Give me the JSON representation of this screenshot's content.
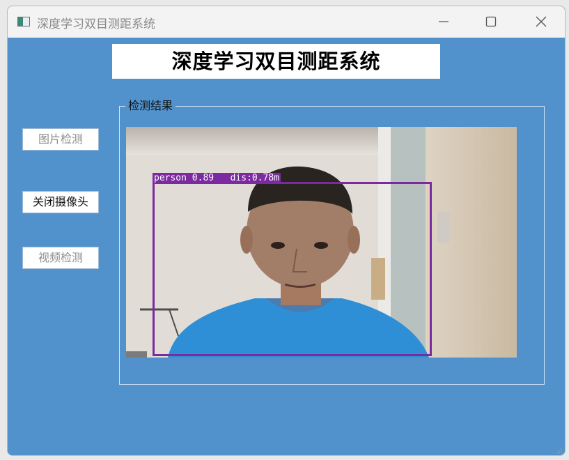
{
  "window": {
    "title": "深度学习双目测距系统",
    "controls": {
      "minimize_icon": "minimize-icon",
      "maximize_icon": "maximize-icon",
      "close_icon": "close-icon"
    }
  },
  "header": {
    "title": "深度学习双目测距系统"
  },
  "sidebar": {
    "buttons": [
      {
        "label": "图片检测",
        "state": "disabled"
      },
      {
        "label": "关闭摄像头",
        "state": "enabled"
      },
      {
        "label": "视频检测",
        "state": "disabled"
      }
    ]
  },
  "results": {
    "group_title": "检测结果",
    "detection": {
      "label": "person 0.89   dis:0.78m",
      "class": "person",
      "confidence": 0.89,
      "distance": "0.78m"
    }
  },
  "colors": {
    "background": "#5192cc",
    "detection_box": "#7c2aa0",
    "titlebar": "#f3f3f3"
  }
}
